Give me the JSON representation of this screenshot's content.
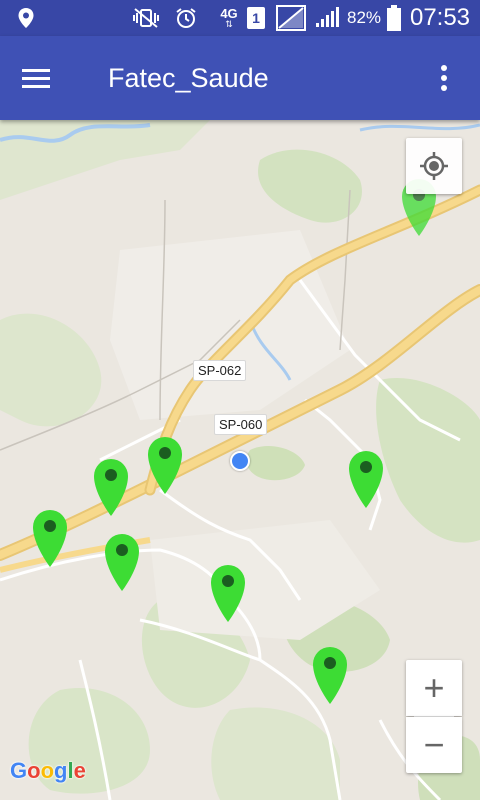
{
  "status_bar": {
    "time": "07:53",
    "battery_percent": "82%",
    "network_type": "4G",
    "sim_slot": "1",
    "icons": [
      "location-icon",
      "vibrate-icon",
      "alarm-icon",
      "network-4g-icon",
      "sim-icon",
      "signal-empty-icon",
      "signal-icon",
      "battery-icon"
    ]
  },
  "app_bar": {
    "title": "Fatec_Saude",
    "menu_icon": "hamburger-menu-icon",
    "overflow_icon": "more-vert-icon"
  },
  "map": {
    "road_labels": [
      "SP-062",
      "SP-060"
    ],
    "controls": {
      "my_location_icon": "my-location-icon",
      "zoom_in_label": "+",
      "zoom_out_label": "−"
    },
    "marker_count": 8,
    "marker_color": "#3ddc34",
    "logo_text": "Google"
  },
  "colors": {
    "primary": "#3f51b5",
    "primary_dark": "#3847a6",
    "highway": "#f7d98c",
    "user_location": "#4285f4"
  }
}
